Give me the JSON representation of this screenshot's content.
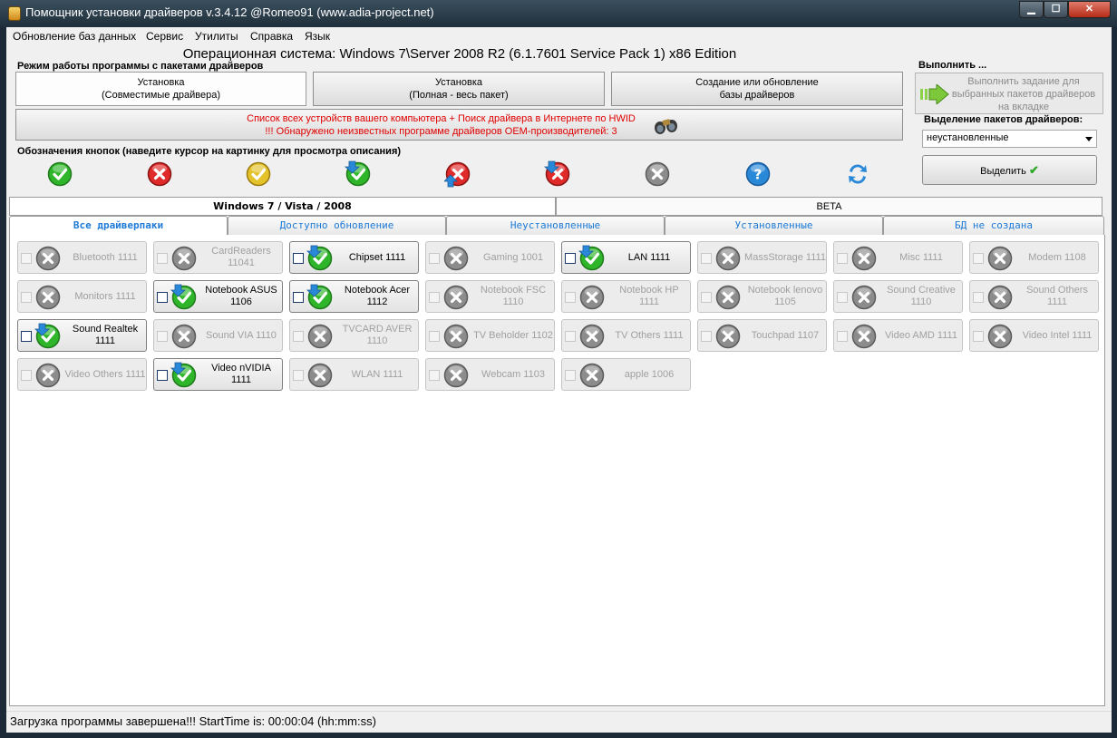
{
  "window": {
    "title": "Помощник установки драйверов v.3.4.12 @Romeo91 (www.adia-project.net)",
    "min_label": "▁",
    "max_label": "☐",
    "close_label": "✕"
  },
  "menu": [
    "Обновление баз данных",
    "Сервис",
    "Утилиты",
    "Справка",
    "Язык"
  ],
  "os_line": "Операционная система: Windows 7\\Server 2008 R2  (6.1.7601 Service Pack 1) x86 Edition",
  "mode_group": {
    "title": "Режим работы программы с пакетами драйверов",
    "buttons": [
      {
        "line1": "Установка",
        "line2": "(Совместимые драйвера)"
      },
      {
        "line1": "Установка",
        "line2": "(Полная - весь пакет)"
      },
      {
        "line1": "Создание или обновление",
        "line2": "базы драйверов"
      }
    ]
  },
  "hwid": {
    "line1": "Список всех устройств вашего компьютера + Поиск драйвера в Интернете по HWID",
    "line2": "!!! Обнаружено неизвестных программе драйверов OEM-производителей: 3",
    "icon": "binoculars-icon"
  },
  "legend": {
    "title": "Обозначения кнопок (наведите курсор на картинку для просмотра описания)",
    "icons": [
      "green-check",
      "red-x",
      "yellow-check",
      "download-green-check",
      "update-red-x",
      "download-red-x",
      "gray-x",
      "help",
      "refresh"
    ]
  },
  "run": {
    "title": "Выполнить ...",
    "button": "Выполнить задание для выбранных пакетов драйверов на вкладке",
    "icon": "green-arrow-icon"
  },
  "selection": {
    "title": "Выделение пакетов драйверов:",
    "combo_value": "неустановленные",
    "button": "Выделить"
  },
  "os_tabs": [
    "Windows 7 / Vista / 2008",
    "BETA"
  ],
  "sub_tabs": [
    "Все драйверпаки",
    "Доступно обновление",
    "Неустановленные",
    "Установленные",
    "БД не создана"
  ],
  "packages": [
    [
      "Bluetooth 1111",
      "gray",
      false
    ],
    [
      "CardReaders\n11041",
      "gray",
      false
    ],
    [
      "Chipset 1111",
      "download-green",
      true
    ],
    [
      "Gaming 1001",
      "gray",
      false
    ],
    [
      "LAN 1111",
      "download-green",
      true
    ],
    [
      "MassStorage 1111",
      "gray",
      false
    ],
    [
      "Misc 1111",
      "gray",
      false
    ],
    [
      "Modem 1108",
      "gray",
      false
    ],
    [
      "Monitors 1111",
      "gray",
      false
    ],
    [
      "Notebook ASUS\n1106",
      "download-green",
      true
    ],
    [
      "Notebook Acer\n1112",
      "download-green",
      true
    ],
    [
      "Notebook FSC\n1110",
      "gray",
      false
    ],
    [
      "Notebook HP\n1111",
      "gray",
      false
    ],
    [
      "Notebook lenovo\n1105",
      "gray",
      false
    ],
    [
      "Sound Creative\n1110",
      "gray",
      false
    ],
    [
      "Sound Others\n1111",
      "gray",
      false
    ],
    [
      "Sound Realtek\n1111",
      "download-green",
      true
    ],
    [
      "Sound VIA 1110",
      "gray",
      false
    ],
    [
      "TVCARD AVER\n1110",
      "gray",
      false
    ],
    [
      "TV Beholder 1102",
      "gray",
      false
    ],
    [
      "TV Others 1111",
      "gray",
      false
    ],
    [
      "Touchpad 1107",
      "gray",
      false
    ],
    [
      "Video AMD 1111",
      "gray",
      false
    ],
    [
      "Video Intel 1111",
      "gray",
      false
    ],
    [
      "Video Others 1111",
      "gray",
      false
    ],
    [
      "Video nVIDIA\n1111",
      "download-green",
      true
    ],
    [
      "WLAN 1111",
      "gray",
      false
    ],
    [
      "Webcam 1103",
      "gray",
      false
    ],
    [
      "apple 1006",
      "gray",
      false
    ]
  ],
  "status": "Загрузка программы завершена!!! StartTime is: 00:00:04 (hh:mm:ss)",
  "colors": {
    "green": "#2fb52a",
    "red": "#e02a2a",
    "yellow": "#e3c22a",
    "gray": "#8c8c8c",
    "blue": "#2a88d8",
    "hwid_text": "#e00000",
    "tab_text": "#1e7ad6"
  }
}
